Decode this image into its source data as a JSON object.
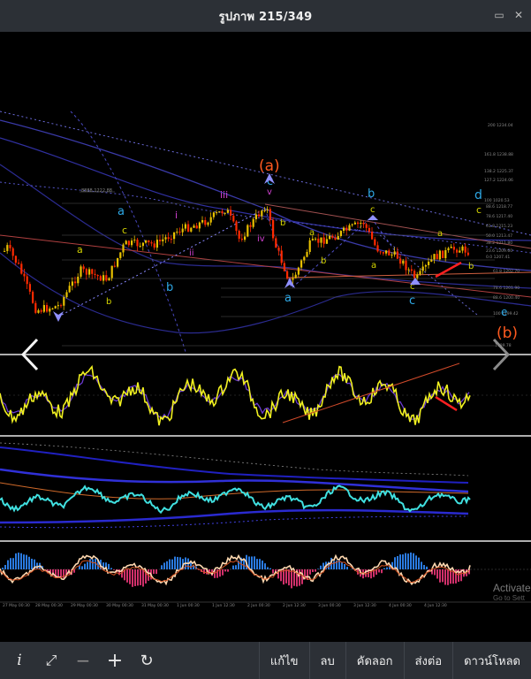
{
  "window": {
    "title": "รูปภาพ 215/349",
    "minimize_glyph": "▭",
    "close_glyph": "✕"
  },
  "chart": {
    "wave_labels": {
      "a_big": "(a)",
      "b_big": "(b)",
      "c_top": "c",
      "v_top": "v",
      "iii": "iii",
      "i": "i",
      "ii": "ii",
      "iv": "iv",
      "a_left": "a",
      "b_left": "b",
      "c_left": "c",
      "b_left_low": "b",
      "a_small1": "a",
      "b_small1": "b",
      "b_right": "b",
      "c_right": "c",
      "a_right": "a",
      "d_label": "d",
      "c_far": "c",
      "e_label": "e",
      "a_bottom": "a",
      "c_bottom": "c",
      "c_bottom2": "c",
      "a_last": "a",
      "b_last": "b",
      "b_mid": "b",
      "a_mid": "a"
    },
    "fib_labels": [
      "200 1234.04",
      "161.8 1238.88",
      "138.2 1225.37",
      "127.2 1224.06",
      "100 1020.53",
      "88.6 1218.77",
      "78.6 1217.40",
      "61.8 1215.23",
      "50.0 1213.47",
      "38.2 1211.80",
      "23.6 1209.60",
      "0.0 1207.41",
      "61.8 1202.70",
      "78.6 1201.90",
      "88.6 1200.40",
      "100 1199.42",
      "1199.78"
    ],
    "top_fib_label": "8888.1222.88",
    "time_axis": [
      "27 May 00:30",
      "28 May 00:30",
      "29 May 00:30",
      "30 May 00:30",
      "31 May 00:30",
      "1 Jun 00:30",
      "1 Jun 12:30",
      "2 Jun 00:30",
      "2 Jun 12:30",
      "3 Jun 00:30",
      "3 Jun 12:30",
      "4 Jun 00:30",
      "4 Jun 12:30"
    ]
  },
  "overlay": {
    "activate_text": "Activate",
    "goto_text": "Go to Sett"
  },
  "toolbar": {
    "info_icon": "i",
    "fullscreen_icon": "⤢",
    "zoom_out_icon": "−",
    "zoom_in_icon": "+",
    "rotate_icon": "↻",
    "edit_label": "แก้ไข",
    "delete_label": "ลบ",
    "copy_label": "คัดลอก",
    "share_label": "ส่งต่อ",
    "download_label": "ดาวน์โหลด"
  },
  "colors": {
    "bar_bg": "#2c3036",
    "wave_orange": "#ff5a1f",
    "wave_cyan": "#2ea8e6",
    "wave_yellow": "#d4d400",
    "wave_magenta": "#d040d0",
    "candle_up": "#e8c000",
    "candle_down": "#ff2a00"
  }
}
